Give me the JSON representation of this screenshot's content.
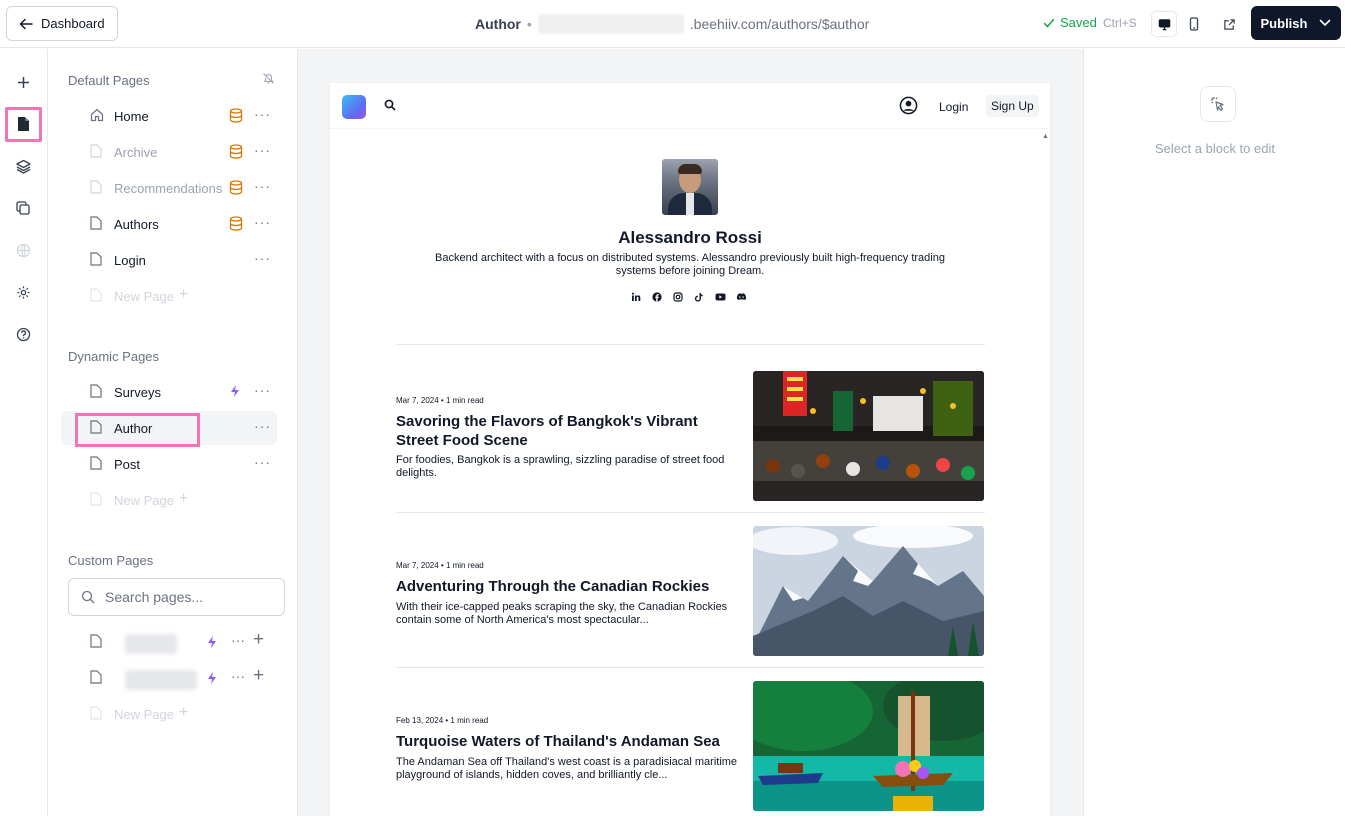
{
  "topbar": {
    "back_label": "Dashboard",
    "page_title": "Author",
    "separator": "•",
    "url_suffix": ".beehiiv.com/authors/$author",
    "saved_label": "Saved",
    "shortcut": "Ctrl+S",
    "publish_label": "Publish"
  },
  "sidebar": {
    "default_title": "Default Pages",
    "default_pages": [
      {
        "label": "Home"
      },
      {
        "label": "Archive"
      },
      {
        "label": "Recommendations"
      },
      {
        "label": "Authors"
      },
      {
        "label": "Login"
      },
      {
        "label": "New Page"
      }
    ],
    "dynamic_title": "Dynamic Pages",
    "dynamic_pages": [
      {
        "label": "Surveys"
      },
      {
        "label": "Author"
      },
      {
        "label": "Post"
      },
      {
        "label": "New Page"
      }
    ],
    "custom_title": "Custom Pages",
    "search_placeholder": "Search pages...",
    "custom_new_page": "New Page"
  },
  "right_panel": {
    "hint": "Select a block to edit"
  },
  "preview": {
    "nav": {
      "login": "Login",
      "signup": "Sign Up"
    },
    "author": {
      "name": "Alessandro Rossi",
      "bio": "Backend architect with a focus on distributed systems. Alessandro previously built high-frequency trading systems before joining Dream."
    },
    "socials": [
      "linkedin-icon",
      "facebook-icon",
      "instagram-icon",
      "tiktok-icon",
      "youtube-icon",
      "discord-icon"
    ],
    "posts": [
      {
        "meta": "Mar 7, 2024 • 1 min read",
        "title": "Savoring the Flavors of Bangkok's Vibrant Street Food Scene",
        "excerpt": "For foodies, Bangkok is a sprawling, sizzling paradise of street food delights."
      },
      {
        "meta": "Mar 7, 2024 • 1 min read",
        "title": "Adventuring Through the Canadian Rockies",
        "excerpt": "With their ice-capped peaks scraping the sky, the Canadian Rockies contain some of North America's most spectacular..."
      },
      {
        "meta": "Feb 13, 2024 • 1 min read",
        "title": "Turquoise Waters of Thailand's Andaman Sea",
        "excerpt": "The Andaman Sea off Thailand's west coast is a paradisiacal maritime playground of islands, hidden coves, and brilliantly cle..."
      }
    ]
  },
  "colors": {
    "accent_pink": "#f472b6",
    "publish_bg": "#0f172a",
    "saved_green": "#16a34a",
    "database_orange": "#d97706",
    "bolt_purple": "#8b5cf6"
  }
}
